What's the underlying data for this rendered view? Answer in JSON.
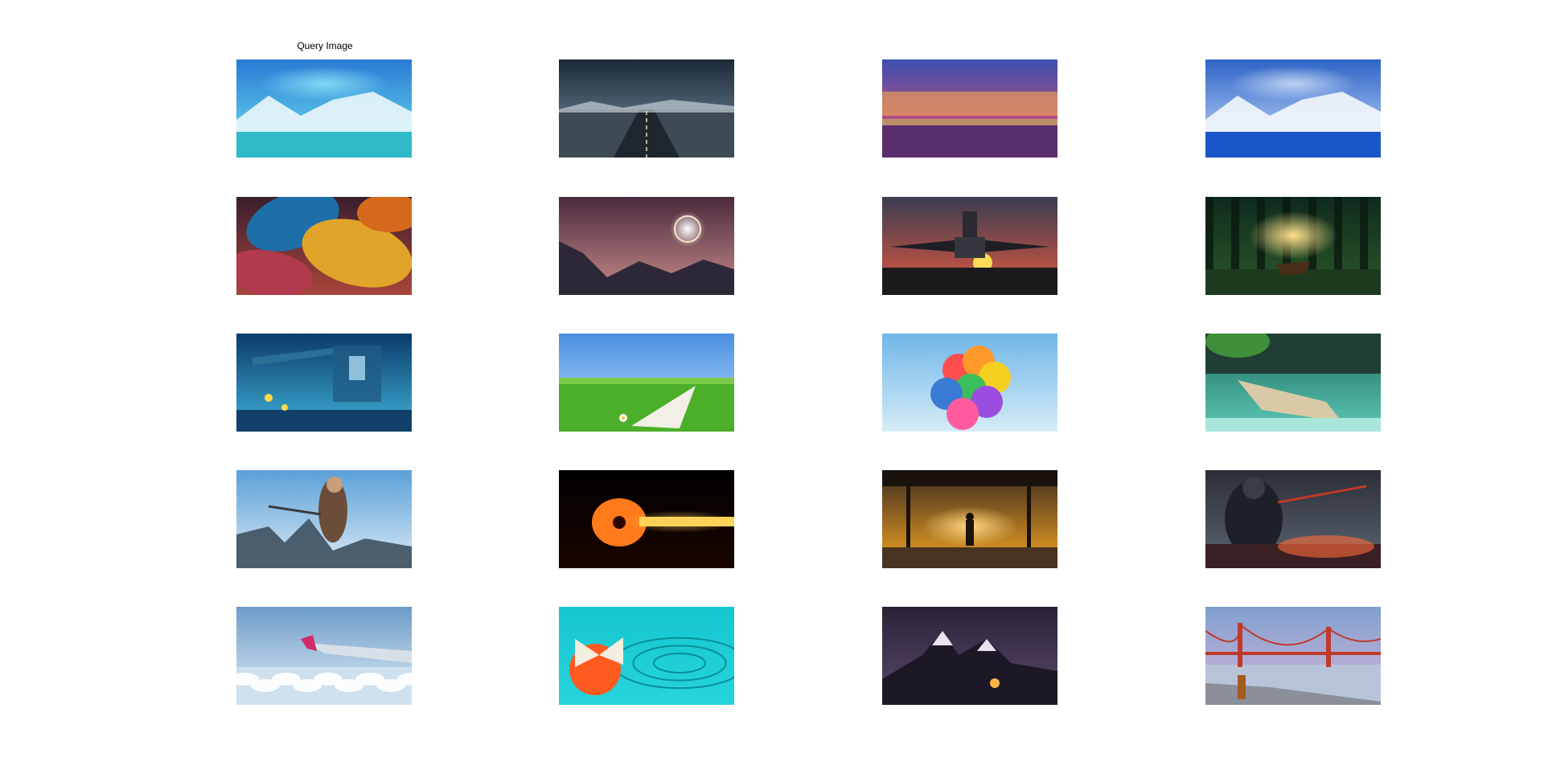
{
  "figure": {
    "query_title": "Query Image"
  },
  "grid": {
    "rows": 5,
    "cols": 4,
    "images": [
      {
        "id": "aurora-lake",
        "kind": "sky-lake",
        "sky": [
          "#2a7bd6",
          "#6fe4ee"
        ],
        "accent": "#eaf6fb",
        "ground": "#2fb9c9",
        "glow": "#9ff6ff"
      },
      {
        "id": "dark-road",
        "kind": "road",
        "sky": [
          "#1c2a38",
          "#7d95aa"
        ],
        "accent": "#d8e2ea",
        "ground": "#20262d",
        "glow": "#c9d6e3"
      },
      {
        "id": "sunset-sea",
        "kind": "sunset",
        "sky": [
          "#3a4fb0",
          "#ff4e6a"
        ],
        "accent": "#ffb347",
        "ground": "#5a2f6e",
        "glow": "#ffd166"
      },
      {
        "id": "snowy-lake",
        "kind": "sky-lake",
        "sky": [
          "#2e63c7",
          "#cfe4ff"
        ],
        "accent": "#f3f7fb",
        "ground": "#1957c9",
        "glow": "#e8f2ff"
      },
      {
        "id": "colorful-leaves",
        "kind": "leaves",
        "sky": [
          "#3b1e2e",
          "#a8453a"
        ],
        "accent": "#e0a42a",
        "ground": "#1e6fa8",
        "glow": "#7cc86b"
      },
      {
        "id": "eclipse-mountains",
        "kind": "eclipse",
        "sky": [
          "#4b2b3d",
          "#c98c8a"
        ],
        "accent": "#ffe6c4",
        "ground": "#2d2838",
        "glow": "#ffffff"
      },
      {
        "id": "jet-sunset",
        "kind": "jet",
        "sky": [
          "#3a3d52",
          "#e4583e"
        ],
        "accent": "#ffb347",
        "ground": "#1a1a1a",
        "glow": "#ffdd55"
      },
      {
        "id": "forest-boat",
        "kind": "forest",
        "sky": [
          "#0f2a1c",
          "#2e5a2c"
        ],
        "accent": "#f0a830",
        "ground": "#1d3a1e",
        "glow": "#ffe08a"
      },
      {
        "id": "underwater-ruins",
        "kind": "underwater",
        "sky": [
          "#0b3b6b",
          "#3fb2d9"
        ],
        "accent": "#bfe9ff",
        "ground": "#12406a",
        "glow": "#ffd94a"
      },
      {
        "id": "paper-plane-field",
        "kind": "field",
        "sky": [
          "#4a90e2",
          "#bfe0ff"
        ],
        "accent": "#f1efe6",
        "ground": "#4caf2a",
        "glow": "#ffffff"
      },
      {
        "id": "balloons",
        "kind": "balloons",
        "sky": [
          "#6fb6e8",
          "#d6ecf7"
        ],
        "accent": "#ff4e4e",
        "ground": "#8fcbe8",
        "glow": "#ffffff"
      },
      {
        "id": "tropical-boat",
        "kind": "tropical",
        "sky": [
          "#1a6b5c",
          "#5fc9b7"
        ],
        "accent": "#d9c9a6",
        "ground": "#37b3a5",
        "glow": "#b6f0e3"
      },
      {
        "id": "action-hero",
        "kind": "action",
        "sky": [
          "#5aa0d8",
          "#dbeaf5"
        ],
        "accent": "#6b4d3a",
        "ground": "#4a5e6e",
        "glow": "#e6c9a6"
      },
      {
        "id": "fire-guitar",
        "kind": "guitar",
        "sky": [
          "#000000",
          "#1a0500"
        ],
        "accent": "#ff7a1a",
        "ground": "#000000",
        "glow": "#ffd25a"
      },
      {
        "id": "silhouette-sunset",
        "kind": "silhouette",
        "sky": [
          "#3b2a1e",
          "#f5a623"
        ],
        "accent": "#1a120c",
        "ground": "#4a3320",
        "glow": "#ffd580"
      },
      {
        "id": "dark-warrior",
        "kind": "warrior",
        "sky": [
          "#2a2e36",
          "#5e6674"
        ],
        "accent": "#c0392b",
        "ground": "#3a2022",
        "glow": "#ff6a3a"
      },
      {
        "id": "airplane-wing",
        "kind": "wing",
        "sky": [
          "#6c9cc8",
          "#e4eef6"
        ],
        "accent": "#d7e0e8",
        "ground": "#cfe0ee",
        "glow": "#ffffff"
      },
      {
        "id": "butterfly-water",
        "kind": "butterfly",
        "sky": [
          "#16c6cf",
          "#26d4dc"
        ],
        "accent": "#ff5a1f",
        "ground": "#0fb8c2",
        "glow": "#ffffff"
      },
      {
        "id": "night-peaks",
        "kind": "peaks",
        "sky": [
          "#2a2238",
          "#5b4a6e"
        ],
        "accent": "#e9e3ef",
        "ground": "#1c1826",
        "glow": "#ffb347"
      },
      {
        "id": "golden-gate",
        "kind": "bridge",
        "sky": [
          "#7f9fcf",
          "#d9b7d9"
        ],
        "accent": "#c0392b",
        "ground": "#8a8f9a",
        "glow": "#e8ecf2"
      }
    ]
  }
}
